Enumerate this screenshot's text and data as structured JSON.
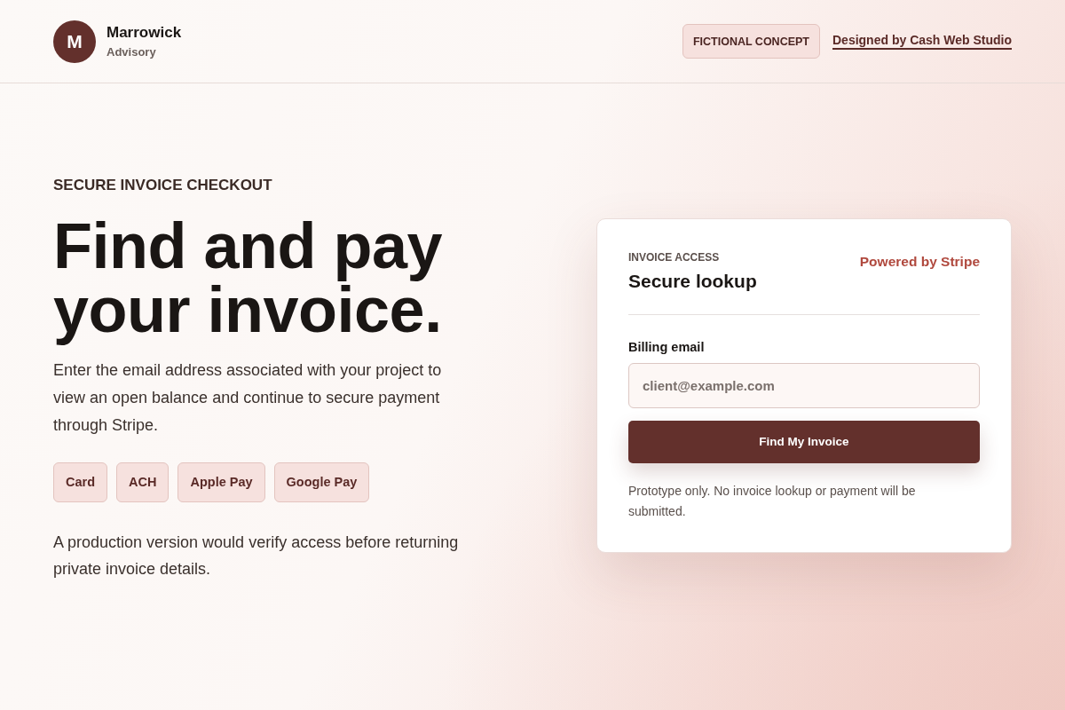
{
  "header": {
    "logo_letter": "M",
    "brand_name": "Marrowick",
    "brand_tagline": "Advisory",
    "badge": "FICTIONAL CONCEPT",
    "credit_link": "Designed by Cash Web Studio"
  },
  "hero": {
    "eyebrow": "SECURE INVOICE CHECKOUT",
    "heading": "Find and pay your invoice.",
    "description": "Enter the email address associated with your project to view an open balance and continue to secure payment through Stripe.",
    "payment_methods": [
      "Card",
      "ACH",
      "Apple Pay",
      "Google Pay"
    ],
    "note": "A production version would verify access before returning private invoice details."
  },
  "lookup_card": {
    "eyebrow": "INVOICE ACCESS",
    "title": "Secure lookup",
    "provider": "Powered by Stripe",
    "email_field": {
      "label": "Billing email",
      "placeholder": "client@example.com"
    },
    "submit_button": "Find My Invoice",
    "disclaimer": "Prototype only. No invoice lookup or payment will be submitted."
  }
}
